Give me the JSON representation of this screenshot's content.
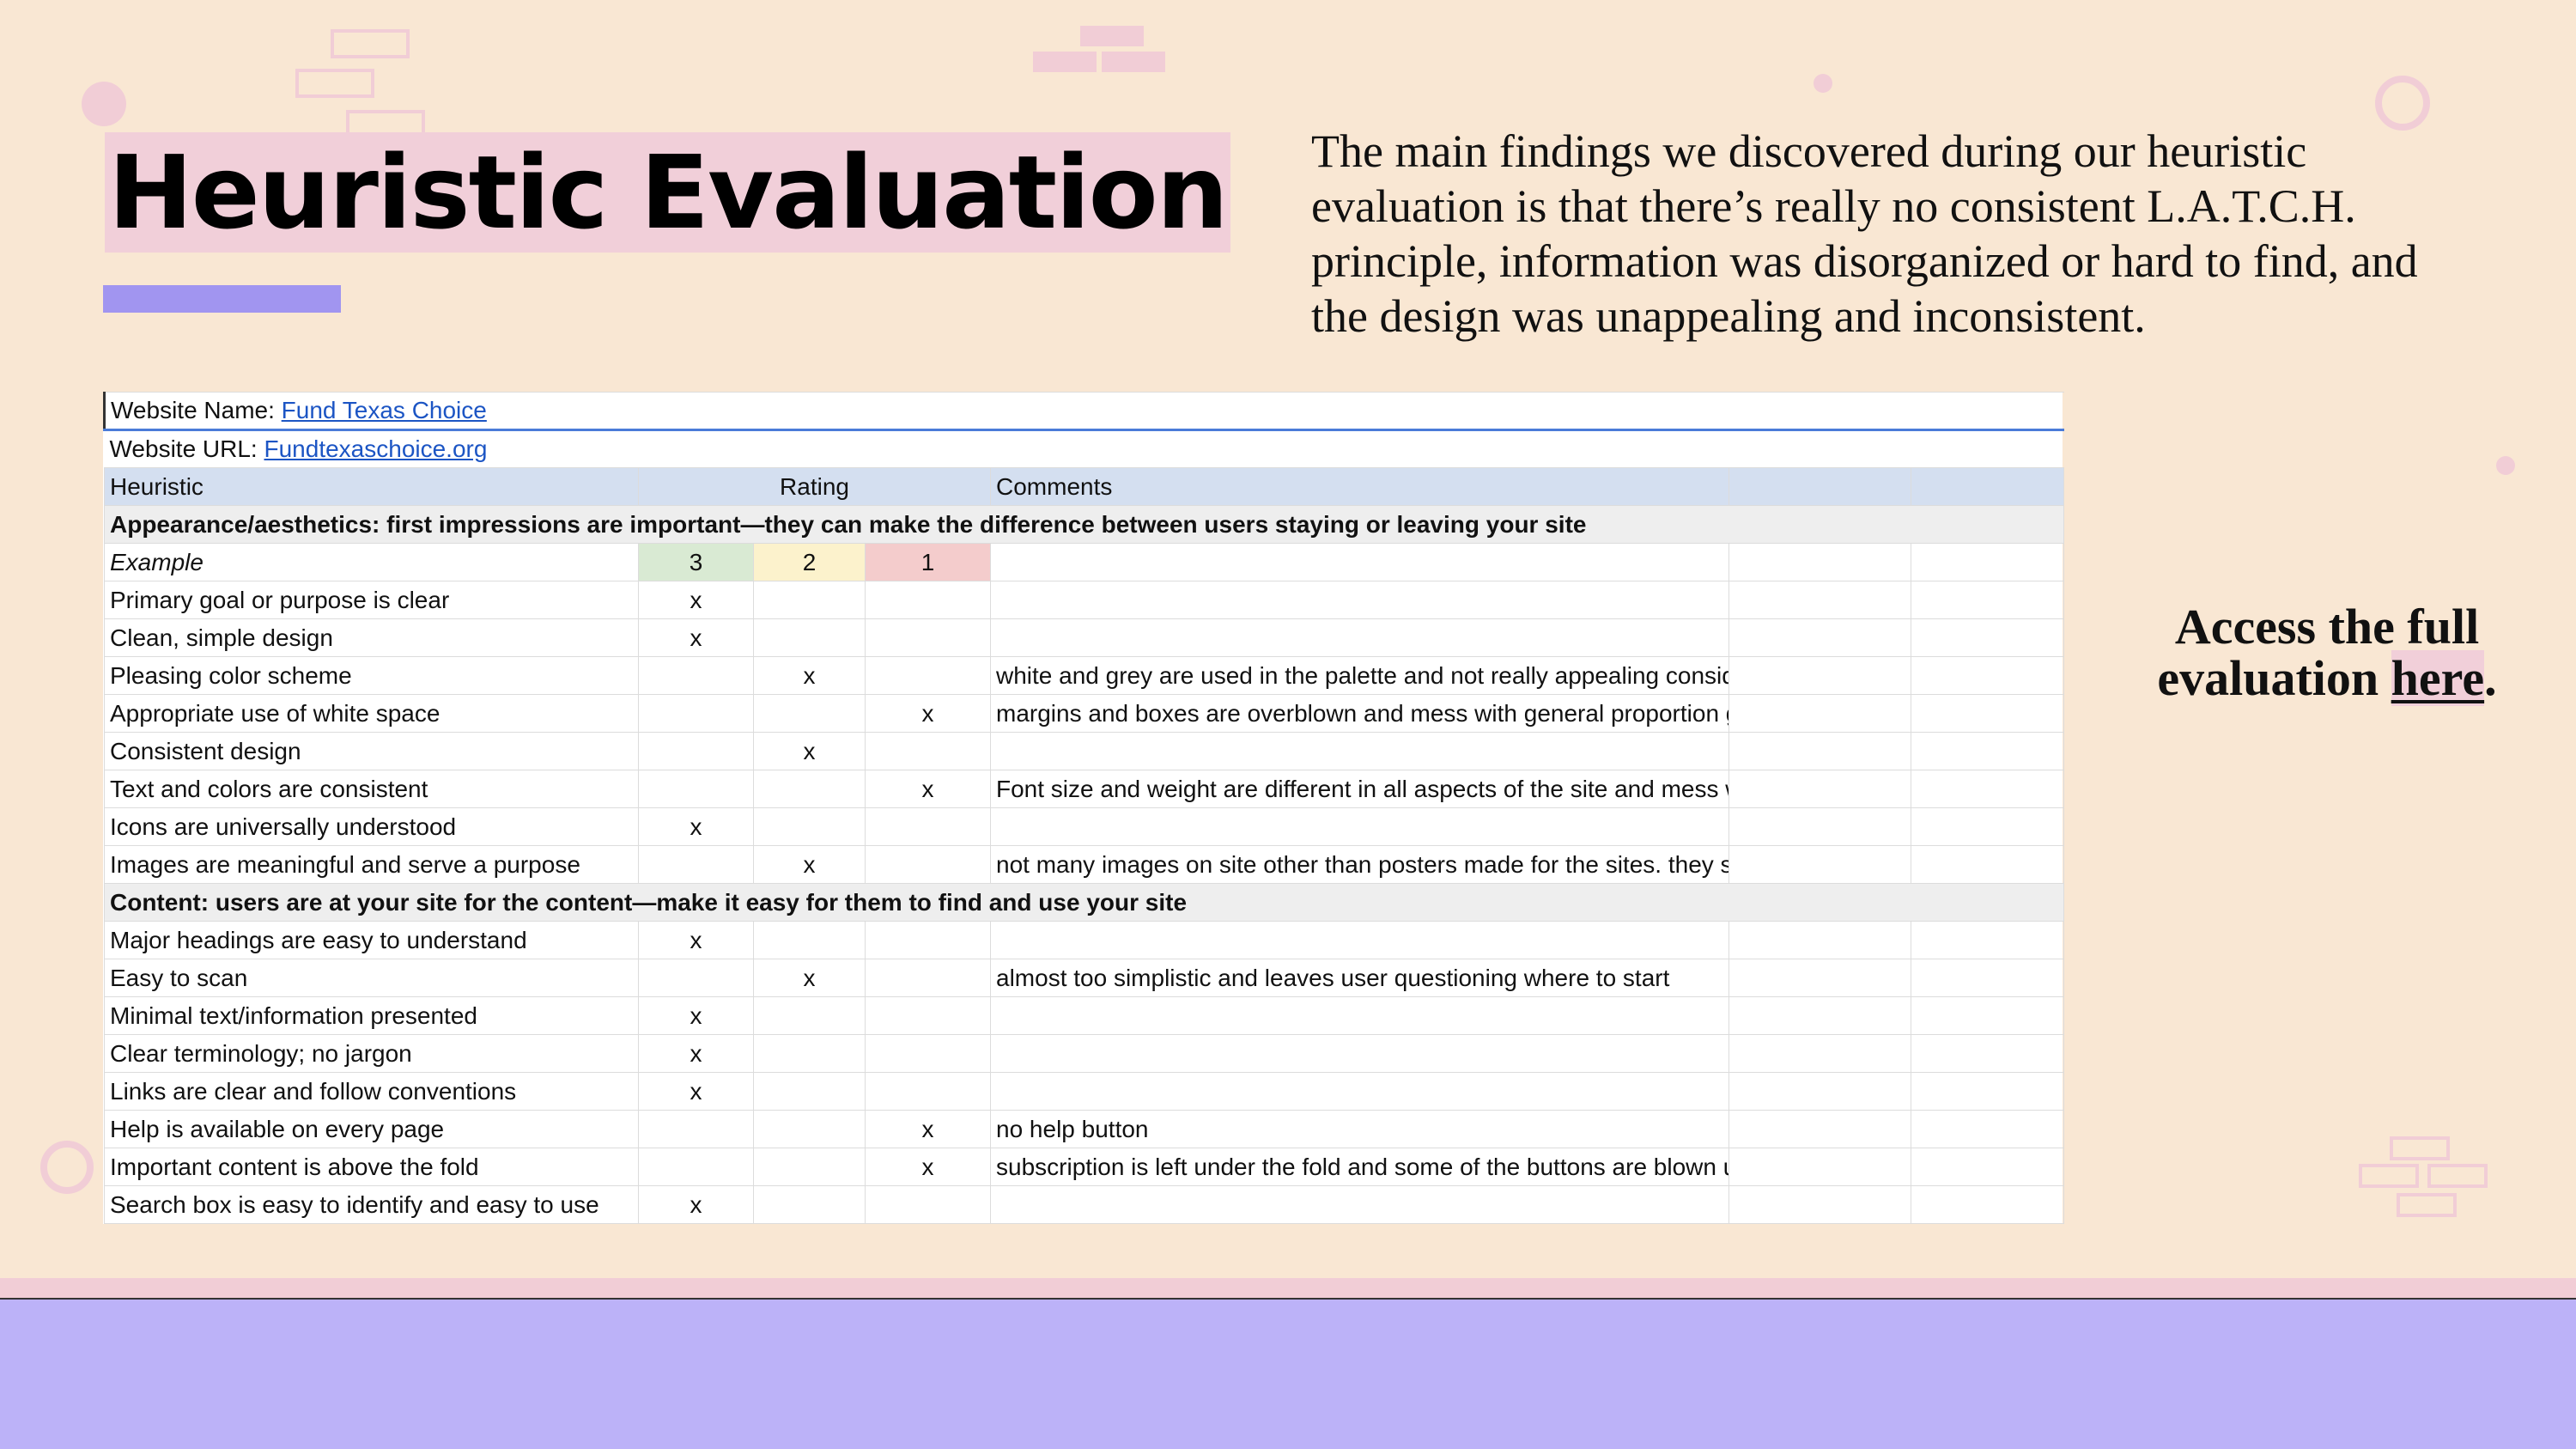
{
  "colors": {
    "background": "#f9e7d3",
    "title_highlight": "#f1cfd9",
    "accent_purple": "#a195f0",
    "bottom_bar": "#bcb2f8",
    "sheet_header": "#d4dff0",
    "rating_3": "#d9ead3",
    "rating_2": "#fcf2cc",
    "rating_1": "#f4cccc",
    "link": "#1c55c4"
  },
  "slide": {
    "title": "Heuristic Evaluation",
    "summary": "The main findings we discovered during our heuristic evaluation is that there’s really no consistent L.A.T.C.H. principle, information was disorganized or hard to find, and the design was unappealing and inconsistent.",
    "access_prefix": "Access the full evaluation ",
    "access_link": "here",
    "access_suffix": "."
  },
  "sheet": {
    "website_name_label": "Website Name: ",
    "website_name_value": "Fund Texas Choice",
    "website_url_label": "Website URL: ",
    "website_url_value": "Fundtexaschoice.org",
    "headers": {
      "heuristic": "Heuristic",
      "rating": "Rating",
      "comments": "Comments"
    },
    "sections": [
      {
        "title": "Appearance/aesthetics: first impressions are important—they can make the difference between users staying or leaving your site",
        "example": {
          "label": "Example",
          "r3": "3",
          "r2": "2",
          "r1": "1"
        },
        "rows": [
          {
            "heuristic": "Primary goal or purpose is clear",
            "r3": "x",
            "r2": "",
            "r1": "",
            "comment": ""
          },
          {
            "heuristic": "Clean, simple design",
            "r3": "x",
            "r2": "",
            "r1": "",
            "comment": ""
          },
          {
            "heuristic": "Pleasing color scheme",
            "r3": "",
            "r2": "x",
            "r1": "",
            "comment": "white and grey are used in the palette and not really appealing considering the other two colors"
          },
          {
            "heuristic": "Appropriate use of white space",
            "r3": "",
            "r2": "",
            "r1": "x",
            "comment": "margins and boxes are overblown and mess with general proportion guidelines"
          },
          {
            "heuristic": "Consistent design",
            "r3": "",
            "r2": "x",
            "r1": "",
            "comment": ""
          },
          {
            "heuristic": "Text and colors are consistent",
            "r3": "",
            "r2": "",
            "r1": "x",
            "comment": "Font size and weight are different in all aspects of the site and mess with the header sizing that cuts o"
          },
          {
            "heuristic": "Icons are universally understood",
            "r3": "x",
            "r2": "",
            "r1": "",
            "comment": ""
          },
          {
            "heuristic": "Images are meaningful and serve a purpose",
            "r3": "",
            "r2": "x",
            "r1": "",
            "comment": "not many images on site other than posters made for the sites. they share a common theme and flow"
          }
        ]
      },
      {
        "title": "Content: users are at your site for the content—make it easy for them to find and use your site",
        "rows": [
          {
            "heuristic": "Major headings are easy to understand",
            "r3": "x",
            "r2": "",
            "r1": "",
            "comment": ""
          },
          {
            "heuristic": "Easy to scan",
            "r3": "",
            "r2": "x",
            "r1": "",
            "comment": "almost too simplistic and leaves user questioning where to start"
          },
          {
            "heuristic": "Minimal text/information presented",
            "r3": "x",
            "r2": "",
            "r1": "",
            "comment": ""
          },
          {
            "heuristic": "Clear terminology; no jargon",
            "r3": "x",
            "r2": "",
            "r1": "",
            "comment": ""
          },
          {
            "heuristic": "Links are clear and follow conventions",
            "r3": "x",
            "r2": "",
            "r1": "",
            "comment": ""
          },
          {
            "heuristic": "Help is available on every page",
            "r3": "",
            "r2": "",
            "r1": "x",
            "comment": "no help button"
          },
          {
            "heuristic": "Important content is above the fold",
            "r3": "",
            "r2": "",
            "r1": "x",
            "comment": "subscription is left under the fold and some of the buttons are blown up disproportionately"
          },
          {
            "heuristic": "Search box is easy to identify and easy to use",
            "r3": "x",
            "r2": "",
            "r1": "",
            "comment": ""
          }
        ]
      }
    ]
  }
}
